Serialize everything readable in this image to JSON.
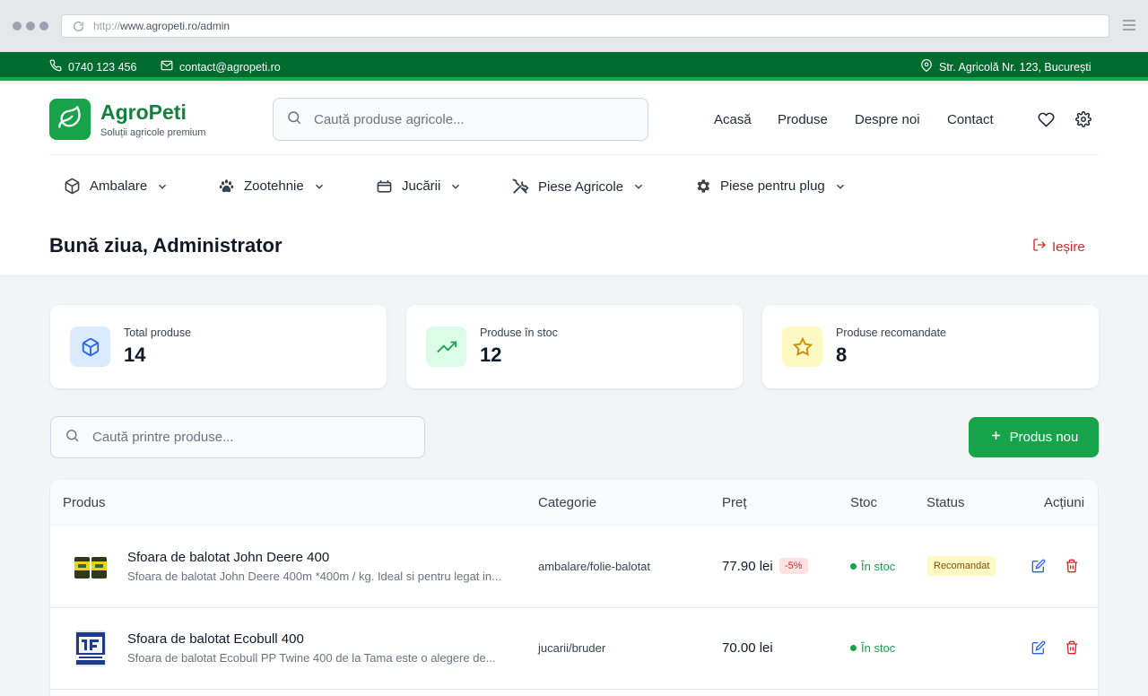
{
  "browser": {
    "url_proto": "http://",
    "url_host": "www.agropeti.ro/admin"
  },
  "topbar": {
    "phone": "0740 123 456",
    "email": "contact@agropeti.ro",
    "address": "Str. Agricolă Nr. 123, București"
  },
  "header": {
    "brand": "AgroPeti",
    "tagline": "Soluții agricole premium",
    "search_placeholder": "Caută produse agricole...",
    "nav": [
      "Acasă",
      "Produse",
      "Despre noi",
      "Contact"
    ],
    "icons": [
      "heart-icon",
      "settings-icon"
    ]
  },
  "categories": [
    {
      "label": "Ambalare",
      "icon": "box-icon"
    },
    {
      "label": "Zootehnie",
      "icon": "paw-icon"
    },
    {
      "label": "Jucării",
      "icon": "toy-icon"
    },
    {
      "label": "Piese Agricole",
      "icon": "tools-icon"
    },
    {
      "label": "Piese pentru plug",
      "icon": "gear-icon"
    }
  ],
  "admin": {
    "greeting": "Bună ziua, Administrator",
    "logout": "Ieșire"
  },
  "stats": [
    {
      "label": "Total produse",
      "value": "14",
      "icon": "box-icon",
      "color": "#dbeafe"
    },
    {
      "label": "Produse în stoc",
      "value": "12",
      "icon": "trending-up-icon",
      "color": "#dcfce7"
    },
    {
      "label": "Produse recomandate",
      "value": "8",
      "icon": "star-icon",
      "color": "#fef9c3"
    }
  ],
  "product_search": {
    "placeholder": "Caută printre produse...",
    "new_button": "Produs nou"
  },
  "table": {
    "headers": [
      "Produs",
      "Categorie",
      "Preț",
      "Stoc",
      "Status",
      "Acțiuni"
    ],
    "rows": [
      {
        "name": "Sfoara de balotat John Deere 400",
        "desc": "Sfoara de balotat John Deere 400m *400m / kg. Ideal si pentru legat in...",
        "category": "ambalare/folie-balotat",
        "price": "77.90 lei",
        "discount": "-5%",
        "stock": "În stoc",
        "status": "Recomandat"
      },
      {
        "name": "Sfoara de balotat Ecobull 400",
        "desc": "Sfoara de balotat Ecobull PP Twine 400 de la Tama este o alegere de...",
        "category": "jucarii/bruder",
        "price": "70.00 lei",
        "discount": "",
        "stock": "În stoc",
        "status": ""
      }
    ]
  },
  "colors": {
    "brand_green": "#16a34a",
    "dark_green": "#006b2e",
    "danger": "#dc2626",
    "edit": "#2563eb"
  }
}
